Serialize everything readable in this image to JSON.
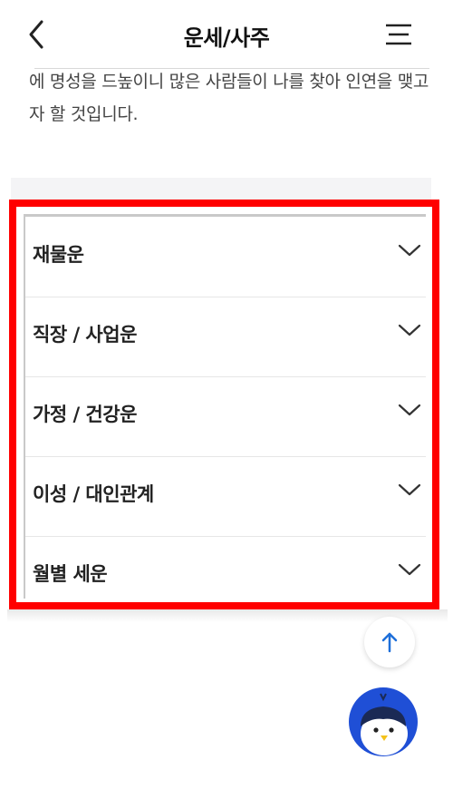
{
  "header": {
    "title": "운세/사주"
  },
  "description": "에 명성을 드높이니 많은 사람들이 나를 찾아 인연을 맺고자 할 것입니다.",
  "accordion": {
    "items": [
      {
        "label": "재물운"
      },
      {
        "label": "직장 / 사업운"
      },
      {
        "label": "가정 / 건강운"
      },
      {
        "label": "이성 / 대인관계"
      },
      {
        "label": "월별 세운"
      }
    ]
  },
  "colors": {
    "highlight": "#ff0000",
    "top_arrow": "#1e6fd9",
    "mascot_bg": "#1f4fd6"
  },
  "icons": [
    "back-icon",
    "menu-icon",
    "chevron-down-icon",
    "arrow-up-icon",
    "penguin-mascot-icon"
  ]
}
